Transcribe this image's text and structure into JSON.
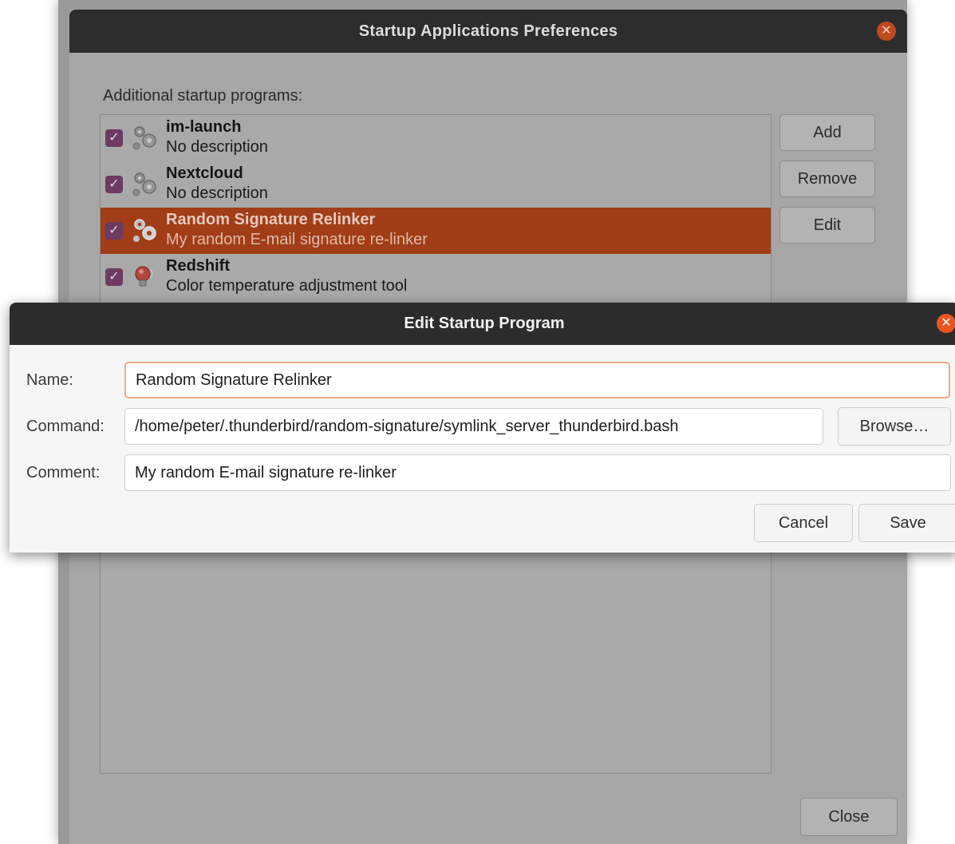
{
  "main_window": {
    "title": "Startup Applications Preferences",
    "section_label": "Additional startup programs:",
    "programs": [
      {
        "name": "im-launch",
        "description": "No description",
        "enabled": true,
        "icon": "gears-icon",
        "selected": false
      },
      {
        "name": "Nextcloud",
        "description": "No description",
        "enabled": true,
        "icon": "gears-icon",
        "selected": false
      },
      {
        "name": "Random Signature Relinker",
        "description": "My random E-mail signature re-linker",
        "enabled": true,
        "icon": "gears-icon",
        "selected": true
      },
      {
        "name": "Redshift",
        "description": "Color temperature adjustment tool",
        "enabled": true,
        "icon": "lightbulb-icon",
        "selected": false
      }
    ],
    "buttons": {
      "add": "Add",
      "remove": "Remove",
      "edit": "Edit",
      "close": "Close"
    }
  },
  "dialog": {
    "title": "Edit Startup Program",
    "fields": {
      "name_label": "Name:",
      "name_value": "Random Signature Relinker",
      "command_label": "Command:",
      "command_value": "/home/peter/.thunderbird/random-signature/symlink_server_thunderbird.bash",
      "comment_label": "Comment:",
      "comment_value": "My random E-mail signature re-linker"
    },
    "buttons": {
      "browse": "Browse…",
      "cancel": "Cancel",
      "save": "Save"
    }
  },
  "colors": {
    "accent": "#e95420",
    "selection": "#a13d17",
    "titlebar": "#2c2c2c",
    "checkbox": "#6d3a63"
  }
}
